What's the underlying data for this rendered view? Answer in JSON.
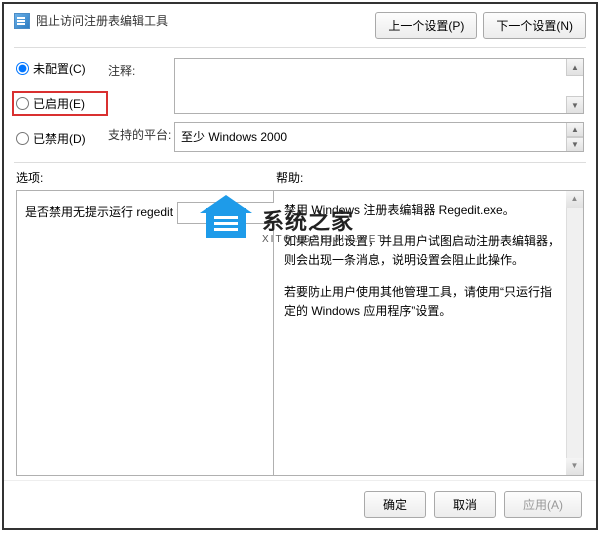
{
  "title": "阻止访问注册表编辑工具",
  "nav": {
    "prev": "上一个设置(P)",
    "next": "下一个设置(N)"
  },
  "radios": {
    "not_configured": "未配置(C)",
    "enabled": "已启用(E)",
    "disabled": "已禁用(D)",
    "selected": "not_configured"
  },
  "fields": {
    "comment_label": "注释:",
    "comment_value": "",
    "platform_label": "支持的平台:",
    "platform_value": "至少 Windows 2000"
  },
  "sections": {
    "options": "选项:",
    "help": "帮助:"
  },
  "options": {
    "question": "是否禁用无提示运行 regedit ?",
    "dropdown_value": ""
  },
  "help": {
    "p1": "禁用 Windows 注册表编辑器 Regedit.exe。",
    "p2": "如果启用此设置，并且用户试图启动注册表编辑器，则会出现一条消息，说明设置会阻止此操作。",
    "p3": "若要防止用户使用其他管理工具，请使用“只运行指定的 Windows 应用程序”设置。"
  },
  "footer": {
    "ok": "确定",
    "cancel": "取消",
    "apply": "应用(A)"
  },
  "watermark": {
    "main": "系统之家",
    "sub": "XITONGZHIJIA.NET"
  }
}
